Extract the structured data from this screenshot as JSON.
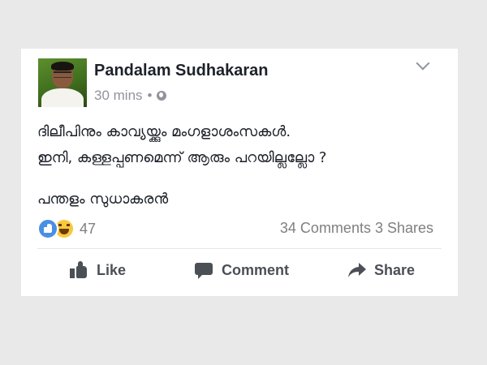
{
  "post": {
    "author": "Pandalam Sudhakaran",
    "time": "30 mins",
    "separator": "•",
    "privacy_icon": "globe-icon",
    "menu_icon": "chevron-down-icon",
    "text_line1": "ദിലീപിനും കാവ്യയ്ക്കും മംഗളാശംസകൾ.",
    "text_line2": "ഇനി, കള്ളപ്പണമെന്ന് ആരും പറയില്ലല്ലോ ?",
    "signature": "പന്തളം സുധാകരൻ"
  },
  "engagement": {
    "reaction_icons": [
      "like-reaction-icon",
      "haha-reaction-icon"
    ],
    "reaction_count": "47",
    "comments_shares": "34 Comments 3 Shares"
  },
  "actions": {
    "like_label": "Like",
    "comment_label": "Comment",
    "share_label": "Share"
  },
  "colors": {
    "page_background": "#e9e9ea",
    "card_background": "#ffffff",
    "author_text": "#1d2129",
    "meta_text": "#90949c",
    "action_text": "#4b4f56",
    "like_blue": "#4a90e2",
    "haha_yellow": "#f7c93f"
  }
}
